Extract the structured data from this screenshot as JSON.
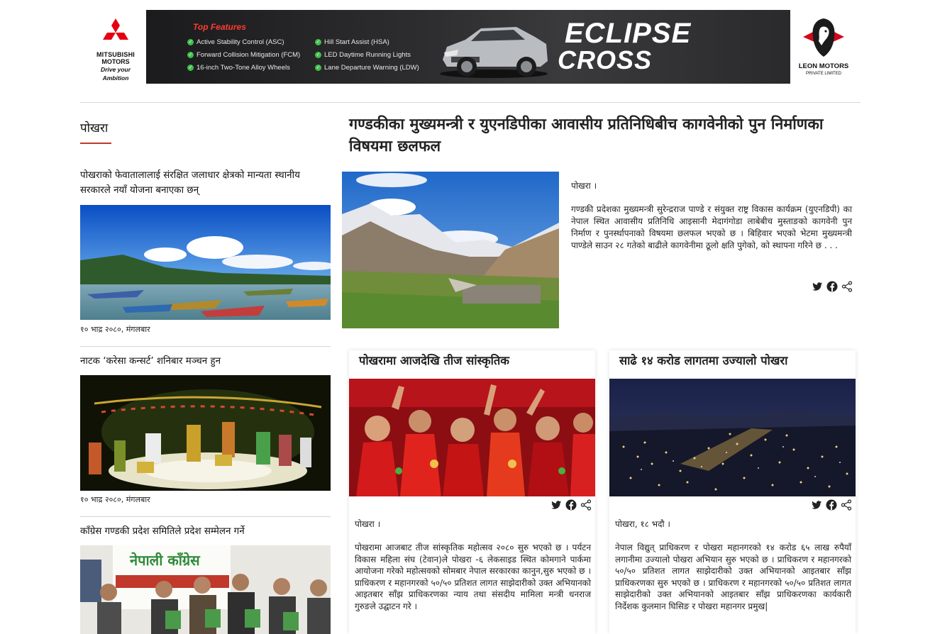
{
  "banner": {
    "left_brand": {
      "name_line1": "MITSUBISHI",
      "name_line2": "MOTORS",
      "tagline": "Drive your Ambition"
    },
    "ad": {
      "features_title": "Top Features",
      "features": [
        "Active Stability Control (ASC)",
        "Forward Collision Mitigation (FCM)",
        "16-inch Two-Tone Alloy Wheels",
        "Hill Start Assist (HSA)",
        "LED Daytime Running Lights",
        "Lane Departure Warning (LDW)"
      ],
      "model_line1": "ECLIPSE",
      "model_line2": "CROSS"
    },
    "right_brand": {
      "name": "LEON MOTORS",
      "sub": "PRIVATE LIMITED"
    }
  },
  "sidebar": {
    "section_title": "पोखरा",
    "items": [
      {
        "title": "पोखराको फेवातालालाई संरक्षित जलाधार क्षेत्रको मान्यता स्थानीय सरकारले नयाँ योजना बनाएका छन्",
        "date": "१० भाद्र २०८०, मंगलबार",
        "image": "lake-boats-photo"
      },
      {
        "title": "नाटक ‘करेसा कन्सर्ट’ शनिबार मञ्चन हुन",
        "date": "१० भाद्र २०८०, मंगलबार",
        "image": "theatre-stage-photo"
      },
      {
        "title": "काँग्रेस गण्डकी प्रदेश समितिले प्रदेश सम्मेलन गर्ने",
        "image": "congress-event-photo",
        "poster_text": "नेपाली काँग्रेस"
      }
    ]
  },
  "main_story": {
    "headline": "गण्डकीका मुख्यमन्त्री र युएनडिपीका आवासीय प्रतिनिधिबीच कागवेनीको पुन निर्माणका विषयमा छलफल",
    "location": "पोखरा ।",
    "body": "गण्डकी प्रदेशका मुख्यमन्त्री सुरेन्द्रराज पाण्डे र संयुक्त राष्ट्र विकास कार्यक्रम (युएनडिपी) का नेपाल स्थित आवासीय प्रतिनिधि आइसानी मेदागंगोडा लाबेबीच मुस्ताङको कागवेनी पुन निर्माण र पुनर्स्थापनाको विषयमा छलफल भएको छ । बिहिवार भएको भेटमा मुख्यमन्त्री पाण्डेले साउन २८ गतेको बाढीले कागवेनीमा ठूलो क्षति पुगेको, को स्थापना गरिने छ . . .",
    "image": "mountain-village-photo"
  },
  "cards": [
    {
      "title": "पोखरामा आजदेखि तीज सांस्कृतिक",
      "location": "पोखरा ।",
      "body": "पोखरामा आजबाट तीज सांस्कृतिक महोत्सव २०८० सुरु भएको छ । पर्यटन विकास महिला संघ (टेवान)ले पोखरा -६ लेकसाइड स्थित कोमगाने पार्कमा आयोजना गरेको महोत्सवको सोमबार नेपाल सरकारका कानुन,सुरु भएको छ ।प्राधिकरण र महानगरको ५०/५० प्रतिशत लागत साझेदारीको उक्त अभियानको आइतबार साँझ प्राधिकरणका न्याय तथा संसदीय मामिला मन्त्री धनराज गुरुङले उद्घाटन गरे ।",
      "image": "teej-dance-photo"
    },
    {
      "title": "साढे १४ करोड लागतमा उज्यालो पोखरा",
      "location": "पोखरा, १८ भदौ ।",
      "body": "नेपाल विद्युत् प्राधिकरण र पोखरा महानगरको १४ करोड ६५ लाख रुपैयाँ लगानीमा उज्यालो पोखरा अभियान सुरु भएको छ । प्राधिकरण र महानगरको ५०/५० प्रतिशत लागत साझेदारीको उक्त अभियानको आइतबार साँझ प्राधिकरणका सुरु भएको छ । प्राधिकरण र महानगरको ५०/५० प्रतिशत लागत साझेदारीको उक्त अभियानको आइतबार साँझ प्राधिकरणका कार्यकारी निर्देशक कुलमान घिसिङ र पोखरा महानगर प्रमुख|",
      "image": "city-night-lights-photo"
    }
  ],
  "share_icons": [
    "twitter-icon",
    "facebook-icon",
    "share-icon"
  ],
  "colors": {
    "accent": "#c0392b",
    "ad_background": "#2b2b2d",
    "feature_title": "#ff3b30",
    "check": "#3fbf4a"
  }
}
